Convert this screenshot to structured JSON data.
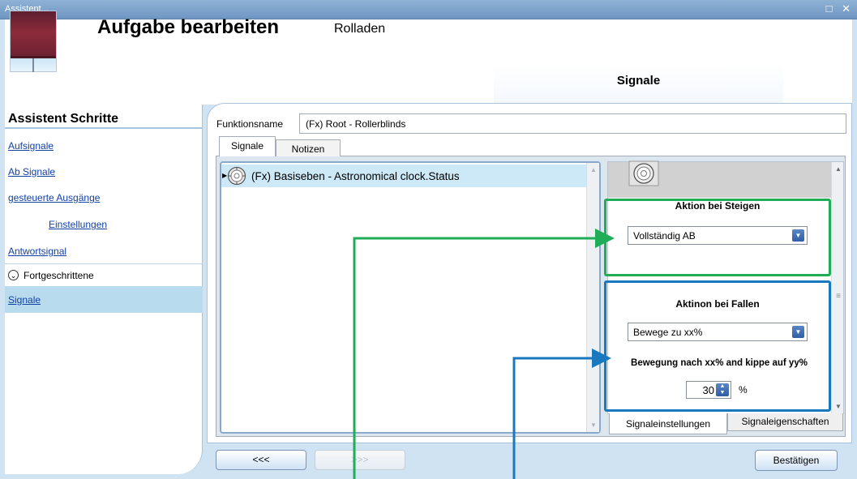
{
  "window": {
    "title": "Assistent...",
    "controls": "□ ✕"
  },
  "header": {
    "title": "Aufgabe bearbeiten",
    "subtitle": "Rolladen",
    "tab": "Signale"
  },
  "sidebar": {
    "heading": "Assistent Schritte",
    "steps": [
      "Aufsignale",
      "Ab Signale",
      "gesteuerte Ausgänge",
      "Einstellungen",
      "Antwortsignal"
    ],
    "advanced_label": "Fortgeschrittene",
    "advanced_items": [
      "Signale"
    ]
  },
  "main": {
    "function_label": "Funktionsname",
    "function_value": "(Fx) Root - Rollerblinds",
    "tabs": [
      "Signale",
      "Notizen"
    ],
    "signals": [
      "(Fx) Basiseben - Astronomical clock.Status"
    ],
    "rise": {
      "label": "Aktion bei Steigen",
      "selected": "Vollständig AB"
    },
    "fall": {
      "label": "Aktinon bei Fallen",
      "selected": "Bewege zu xx%",
      "move_label": "Bewegung nach xx% and kippe auf yy%",
      "value": "30",
      "unit": "%"
    },
    "bottom_tabs": [
      "Signaleinstellungen",
      "Signaleigenschaften"
    ]
  },
  "buttons": {
    "back": "<<<",
    "next": ">>>",
    "confirm": "Bestätigen"
  },
  "colors": {
    "green_highlight": "#1fae57",
    "blue_highlight": "#1a78bf",
    "selection": "#b9dbee"
  }
}
